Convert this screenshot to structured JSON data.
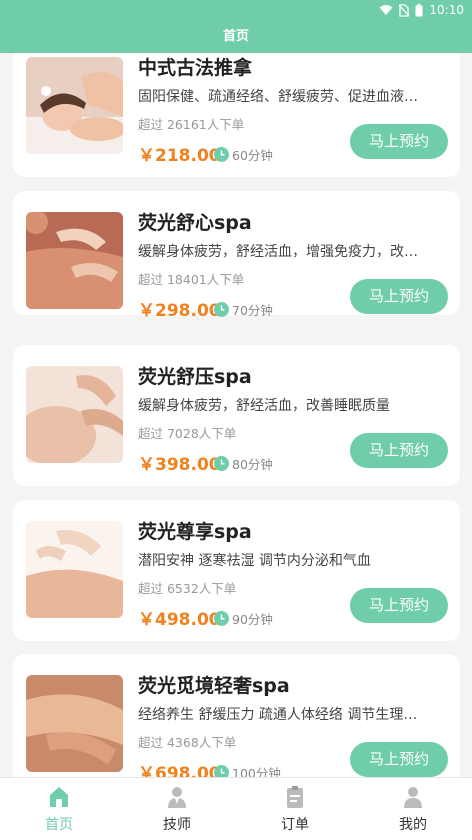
{
  "status_bar": {
    "time": "10:10"
  },
  "header": {
    "title": "首页"
  },
  "accent_color": "#6fcda9",
  "price_color": "#f0821e",
  "items": [
    {
      "title": "中式古法推拿",
      "desc": "固阳保健、疏通经络、舒缓疲劳、促进血液…",
      "sold": "超过 26161人下单",
      "price": "￥218.00",
      "duration": "60分钟",
      "button": "马上预约",
      "image": "massage-face-photo"
    },
    {
      "title": "荧光舒心spa",
      "desc": "缓解身体疲劳，舒经活血，增强免疫力，改…",
      "sold": "超过 18401人下单",
      "price": "￥298.00",
      "duration": "70分钟",
      "button": "马上预约",
      "image": "massage-shoulder-photo"
    },
    {
      "title": "荧光舒压spa",
      "desc": "缓解身体疲劳，舒经活血，改善睡眠质量",
      "sold": "超过 7028人下单",
      "price": "￥398.00",
      "duration": "80分钟",
      "button": "马上预约",
      "image": "massage-neck-photo"
    },
    {
      "title": "荧光尊享spa",
      "desc": "潜阳安神 逐寒祛湿 调节内分泌和气血",
      "sold": "超过 6532人下单",
      "price": "￥498.00",
      "duration": "90分钟",
      "button": "马上预约",
      "image": "massage-back-photo"
    },
    {
      "title": "荧光觅境轻奢spa",
      "desc": "经络养生 舒缓压力 疏通人体经络 调节生理…",
      "sold": "超过 4368人下单",
      "price": "￥698.00",
      "duration": "100分钟",
      "button": "马上预约",
      "image": "massage-arm-photo"
    }
  ],
  "tabs": [
    {
      "label": "首页",
      "icon": "home-icon",
      "active": true
    },
    {
      "label": "技师",
      "icon": "technician-icon",
      "active": false
    },
    {
      "label": "订单",
      "icon": "order-icon",
      "active": false
    },
    {
      "label": "我的",
      "icon": "profile-icon",
      "active": false
    }
  ]
}
